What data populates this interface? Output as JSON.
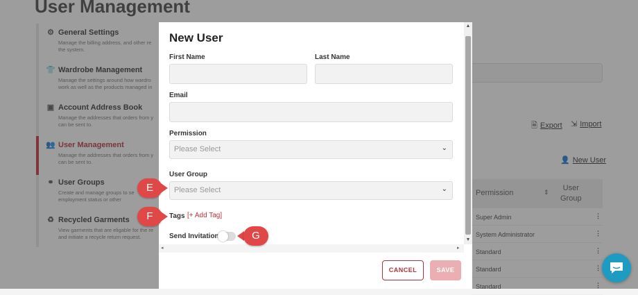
{
  "page": {
    "title": "User Management"
  },
  "sidebar": {
    "items": [
      {
        "icon": "gear-icon",
        "glyph": "⚙",
        "label": "General Settings",
        "desc": "Manage the billing address, and other re\nthe system."
      },
      {
        "icon": "shirt-icon",
        "glyph": "👕",
        "label": "Wardrobe Management",
        "desc": "Manage the settings around how wardro\nwork as well as the products managed in"
      },
      {
        "icon": "address-book-icon",
        "glyph": "▣",
        "label": "Account Address Book",
        "desc": "Manage the addresses that orders from y\ncan be sent to."
      },
      {
        "icon": "users-icon",
        "glyph": "👥",
        "label": "User Management",
        "desc": "Manage the addresses that orders from y\ncan be sent to."
      },
      {
        "icon": "user-groups-icon",
        "glyph": "⚭",
        "label": "User Groups",
        "desc": "Create and manage groups to se\nemployment status or other"
      },
      {
        "icon": "recycle-icon",
        "glyph": "♻",
        "label": "Recycled Garments",
        "desc": "View garments that are eligable for the re\nand initiate a recycle return request."
      }
    ]
  },
  "toolbar": {
    "export": "Export",
    "import": "Import",
    "new_user": "New User"
  },
  "table": {
    "headers": {
      "permission": "Permission",
      "user_group": "User\nGroup"
    },
    "rows": [
      "Super Admin",
      "System Administrator",
      "Standard",
      "Standard",
      "Standard"
    ]
  },
  "modal": {
    "title": "New User",
    "first_name": {
      "label": "First Name",
      "value": ""
    },
    "last_name": {
      "label": "Last Name",
      "value": ""
    },
    "email": {
      "label": "Email",
      "value": ""
    },
    "permission": {
      "label": "Permission",
      "placeholder": "Please Select"
    },
    "user_group": {
      "label": "User Group",
      "placeholder": "Please Select"
    },
    "tags": {
      "label": "Tags",
      "add_label": "[+ Add Tag]"
    },
    "send_invitation": {
      "label": "Send Invitation",
      "enabled": false
    },
    "cancel_label": "CANCEL",
    "save_label": "SAVE"
  },
  "callouts": {
    "e": "E",
    "f": "F",
    "g": "G"
  },
  "colors": {
    "accent": "#c0303d",
    "callout": "#e04848",
    "chat": "#1e9bc0"
  }
}
